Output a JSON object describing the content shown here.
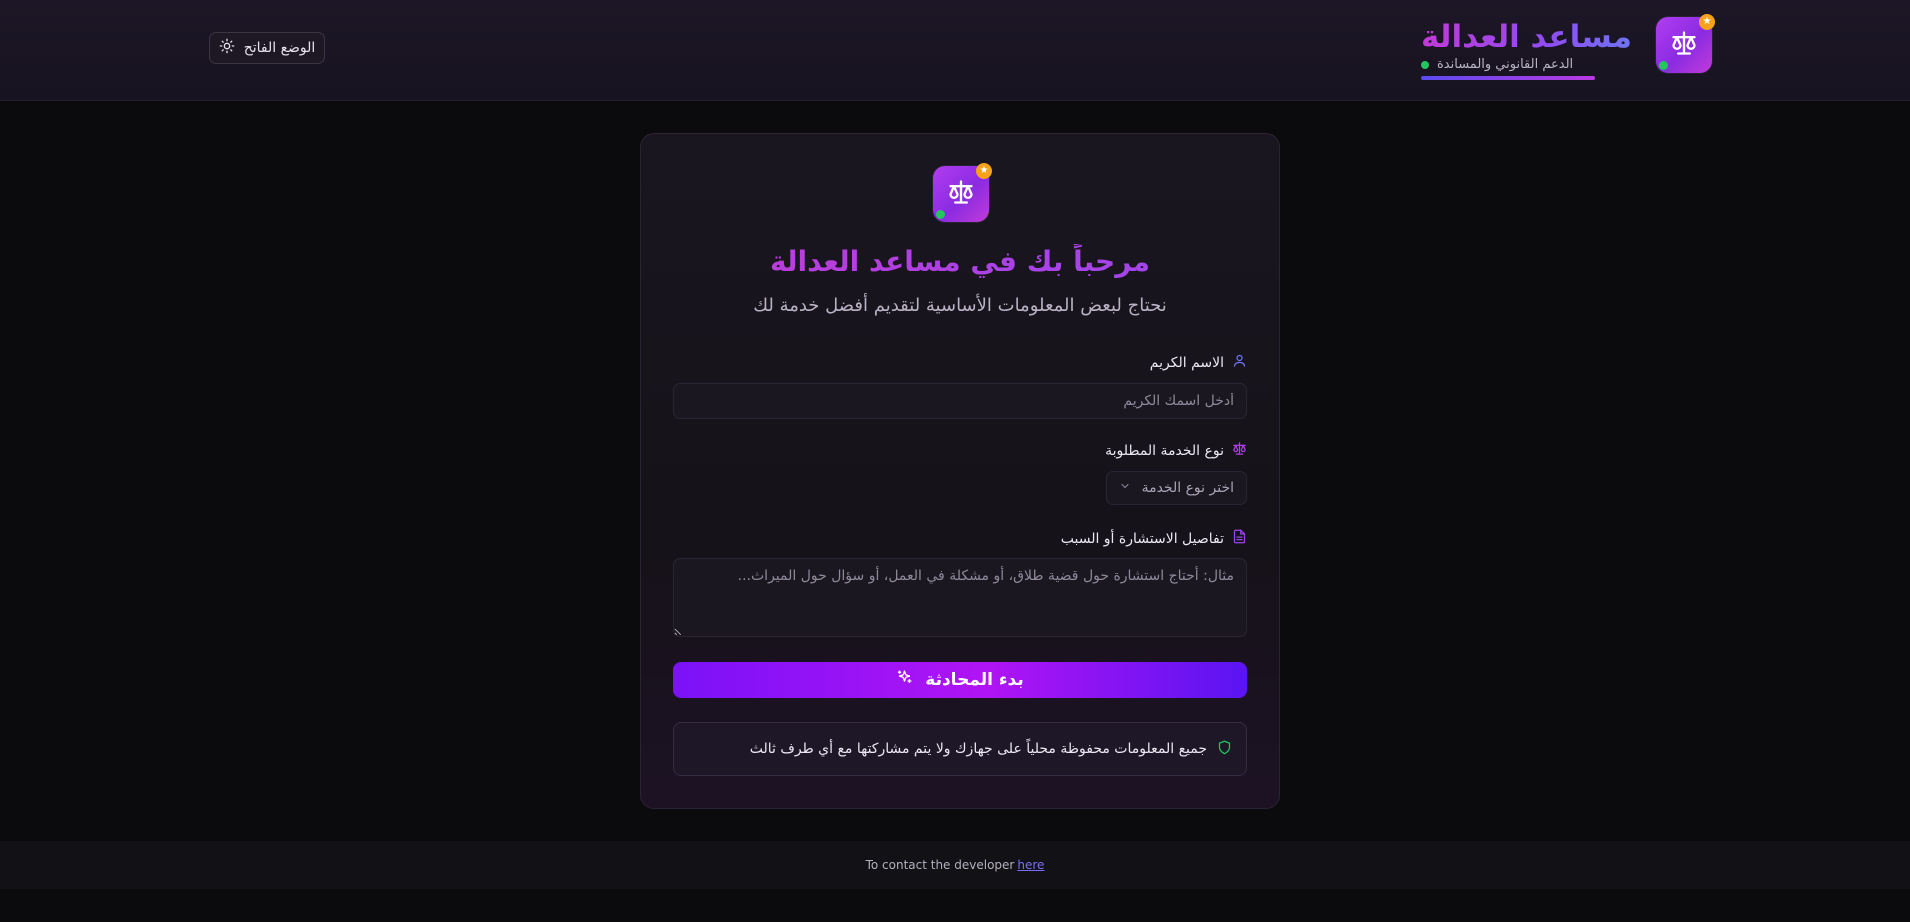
{
  "header": {
    "brand_title": "مساعد العدالة",
    "brand_subtitle": "الدعم القانوني والمساندة",
    "theme_toggle_label": "الوضع الفاتح",
    "logo_icon": "scales-icon",
    "theme_icon": "sun-icon"
  },
  "card": {
    "title": "مرحباً بك في مساعد العدالة",
    "subtitle": "نحتاج لبعض المعلومات الأساسية لتقديم أفضل خدمة لك",
    "name_field": {
      "label": "الاسم الكريم",
      "placeholder": "أدخل اسمك الكريم",
      "value": "",
      "icon": "user-icon"
    },
    "service_field": {
      "label": "نوع الخدمة المطلوبة",
      "selected": "اختر نوع الخدمة",
      "icon": "scales-icon"
    },
    "details_field": {
      "label": "تفاصيل الاستشارة أو السبب",
      "placeholder": "مثال: أحتاج استشارة حول قضية طلاق، أو مشكلة في العمل، أو سؤال حول الميراث...",
      "value": "",
      "icon": "document-icon"
    },
    "start_button_label": "بدء المحادثة",
    "start_button_icon": "sparkles-icon",
    "privacy_note": "جميع المعلومات محفوظة محلياً على جهازك ولا يتم مشاركتها مع أي طرف ثالث",
    "privacy_icon": "shield-icon"
  },
  "footer": {
    "text": "To contact the developer",
    "link_label": "here"
  },
  "colors": {
    "accent_purple": "#8a2be2",
    "accent_magenta": "#c23ad8",
    "status_green": "#22c55e",
    "star_badge": "#f7a21b"
  }
}
